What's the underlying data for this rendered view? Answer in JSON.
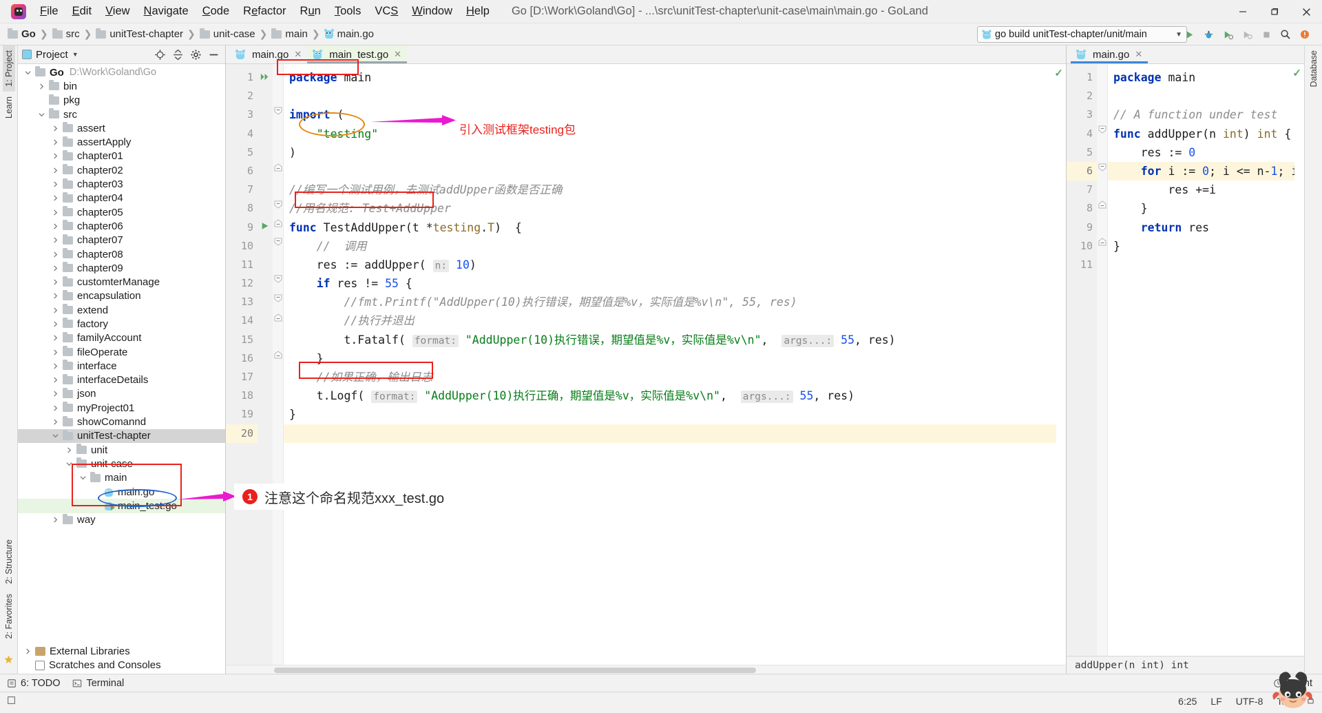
{
  "titlebar": {
    "menus": [
      "File",
      "Edit",
      "View",
      "Navigate",
      "Code",
      "Refactor",
      "Run",
      "Tools",
      "VCS",
      "Window",
      "Help"
    ],
    "window_title": "Go [D:\\Work\\Goland\\Go] - ...\\src\\unitTest-chapter\\unit-case\\main\\main.go - GoLand",
    "minimize": "—",
    "maximize": "❐",
    "close": "✕"
  },
  "navbar": {
    "breadcrumbs": [
      {
        "label": "Go",
        "icon": "folder-icon",
        "bold": true
      },
      {
        "label": "src",
        "icon": "folder-icon",
        "bold": false
      },
      {
        "label": "unitTest-chapter",
        "icon": "folder-icon",
        "bold": false
      },
      {
        "label": "unit-case",
        "icon": "folder-icon",
        "bold": false
      },
      {
        "label": "main",
        "icon": "folder-icon",
        "bold": false
      },
      {
        "label": "main.go",
        "icon": "go-file-icon",
        "bold": false
      }
    ],
    "run_config": "go build unitTest-chapter/unit/main",
    "icons": [
      "run-icon",
      "debug-icon",
      "run-with-coverage-icon",
      "profile-icon",
      "stop-icon",
      "search-icon",
      "updates-icon"
    ]
  },
  "left_strip": {
    "tabs": [
      {
        "label": "1: Project",
        "selected": true
      },
      {
        "label": "Learn",
        "selected": false
      }
    ],
    "bottom": [
      {
        "label": "2: Structure"
      },
      {
        "label": "2: Favorites"
      }
    ]
  },
  "project_panel": {
    "title": "Project",
    "actions": [
      "locate-icon",
      "collapse-all-icon",
      "settings-icon",
      "hide-icon"
    ],
    "tree": [
      {
        "depth": 0,
        "arrow": "down",
        "icon": "folder-icon",
        "label": "Go",
        "bold": true,
        "path": "D:\\Work\\Goland\\Go"
      },
      {
        "depth": 1,
        "arrow": "right",
        "icon": "folder-icon",
        "label": "bin"
      },
      {
        "depth": 1,
        "arrow": "none",
        "icon": "folder-icon",
        "label": "pkg"
      },
      {
        "depth": 1,
        "arrow": "down",
        "icon": "folder-icon",
        "label": "src"
      },
      {
        "depth": 2,
        "arrow": "right",
        "icon": "folder-icon",
        "label": "assert"
      },
      {
        "depth": 2,
        "arrow": "right",
        "icon": "folder-icon",
        "label": "assertApply"
      },
      {
        "depth": 2,
        "arrow": "right",
        "icon": "folder-icon",
        "label": "chapter01"
      },
      {
        "depth": 2,
        "arrow": "right",
        "icon": "folder-icon",
        "label": "chapter02"
      },
      {
        "depth": 2,
        "arrow": "right",
        "icon": "folder-icon",
        "label": "chapter03"
      },
      {
        "depth": 2,
        "arrow": "right",
        "icon": "folder-icon",
        "label": "chapter04"
      },
      {
        "depth": 2,
        "arrow": "right",
        "icon": "folder-icon",
        "label": "chapter05"
      },
      {
        "depth": 2,
        "arrow": "right",
        "icon": "folder-icon",
        "label": "chapter06"
      },
      {
        "depth": 2,
        "arrow": "right",
        "icon": "folder-icon",
        "label": "chapter07"
      },
      {
        "depth": 2,
        "arrow": "right",
        "icon": "folder-icon",
        "label": "chapter08"
      },
      {
        "depth": 2,
        "arrow": "right",
        "icon": "folder-icon",
        "label": "chapter09"
      },
      {
        "depth": 2,
        "arrow": "right",
        "icon": "folder-icon",
        "label": "customterManage"
      },
      {
        "depth": 2,
        "arrow": "right",
        "icon": "folder-icon",
        "label": "encapsulation"
      },
      {
        "depth": 2,
        "arrow": "right",
        "icon": "folder-icon",
        "label": "extend"
      },
      {
        "depth": 2,
        "arrow": "right",
        "icon": "folder-icon",
        "label": "factory"
      },
      {
        "depth": 2,
        "arrow": "right",
        "icon": "folder-icon",
        "label": "familyAccount"
      },
      {
        "depth": 2,
        "arrow": "right",
        "icon": "folder-icon",
        "label": "fileOperate"
      },
      {
        "depth": 2,
        "arrow": "right",
        "icon": "folder-icon",
        "label": "interface"
      },
      {
        "depth": 2,
        "arrow": "right",
        "icon": "folder-icon",
        "label": "interfaceDetails"
      },
      {
        "depth": 2,
        "arrow": "right",
        "icon": "folder-icon",
        "label": "json"
      },
      {
        "depth": 2,
        "arrow": "right",
        "icon": "folder-icon",
        "label": "myProject01"
      },
      {
        "depth": 2,
        "arrow": "right",
        "icon": "folder-icon",
        "label": "showComannd"
      },
      {
        "depth": 2,
        "arrow": "down",
        "icon": "folder-icon",
        "label": "unitTest-chapter",
        "selected": true
      },
      {
        "depth": 3,
        "arrow": "right",
        "icon": "folder-icon",
        "label": "unit"
      },
      {
        "depth": 3,
        "arrow": "down",
        "icon": "folder-icon",
        "label": "unit-case"
      },
      {
        "depth": 4,
        "arrow": "down",
        "icon": "folder-icon",
        "label": "main"
      },
      {
        "depth": 5,
        "arrow": "none",
        "icon": "go-file-icon",
        "label": "main.go"
      },
      {
        "depth": 5,
        "arrow": "none",
        "icon": "go-test-file-icon",
        "label": "main_test.go",
        "green": true
      },
      {
        "depth": 2,
        "arrow": "right",
        "icon": "folder-icon",
        "label": "way"
      }
    ],
    "footer": [
      {
        "arrow": "right",
        "icon": "library-icon",
        "label": "External Libraries"
      },
      {
        "arrow": "none",
        "icon": "scratch-icon",
        "label": "Scratches and Consoles"
      }
    ]
  },
  "editor_left": {
    "tabs": [
      {
        "label": "main.go",
        "icon": "go-file-icon",
        "active": false
      },
      {
        "label": "main_test.go",
        "icon": "go-test-file-icon",
        "active": true
      }
    ],
    "line_numbers": [
      "1",
      "2",
      "3",
      "4",
      "5",
      "6",
      "7",
      "8",
      "9",
      "10",
      "11",
      "12",
      "13",
      "14",
      "15",
      "16",
      "17",
      "18",
      "19",
      "20"
    ],
    "lines": [
      "package main",
      "",
      "import (",
      "    \"testing\"",
      ")",
      "",
      "//编写一个测试用例，去测试addUpper函数是否正确",
      "//用名规范: Test+AddUpper",
      "func TestAddUpper(t *testing.T)  {",
      "    //  调用",
      "    res := addUpper( n: 10)",
      "    if res != 55 {",
      "        //fmt.Printf(\"AddUpper(10)执行错误，期望值是%v，实际值是%v\\n\", 55, res)",
      "        //执行并退出",
      "        t.Fatalf( format: \"AddUpper(10)执行错误，期望值是%v，实际值是%v\\n\",  args...: 55, res)",
      "    }",
      "    //如果正确，输出日志",
      "    t.Logf( format: \"AddUpper(10)执行正确，期望值是%v，实际值是%v\\n\",  args...: 55, res)",
      "}",
      ""
    ],
    "highlighted_line": 20
  },
  "editor_right": {
    "tabs": [
      {
        "label": "main.go",
        "icon": "go-file-icon",
        "active": true
      }
    ],
    "line_numbers": [
      "1",
      "2",
      "3",
      "4",
      "5",
      "6",
      "7",
      "8",
      "9",
      "10",
      "11"
    ],
    "lines": [
      "package main",
      "",
      "// A function under test",
      "func addUpper(n int) int {",
      "    res := 0",
      "    for i := 0; i <= n-1; i++ {",
      "        res +=i",
      "    }",
      "    return res",
      "}",
      ""
    ],
    "highlighted_line": 6,
    "status": "addUpper(n int) int"
  },
  "annotations": {
    "testing_note": "引入测试框架testing包",
    "filename_note": "注意这个命名规范xxx_test.go",
    "filename_badge": "1"
  },
  "bottom_toolbar": {
    "items": [
      {
        "label": "6: TODO",
        "icon": "todo-icon"
      },
      {
        "label": "Terminal",
        "icon": "terminal-icon"
      }
    ],
    "right": [
      {
        "label": "Event",
        "icon": "event-icon"
      }
    ]
  },
  "statusbar": {
    "caret": "6:25",
    "line_separator": "LF",
    "encoding": "UTF-8",
    "indent": "Tab",
    "lock_icon": "lock-icon"
  },
  "right_strip": {
    "tabs": [
      {
        "label": "Database"
      }
    ]
  },
  "colors": {
    "accent_red": "#e8211c",
    "accent_magenta": "#e91ad0",
    "accent_orange": "#e8860a",
    "keyword_blue": "#0033b3",
    "string_green": "#067d17",
    "number_blue": "#1750eb",
    "comment_gray": "#8c8c8c",
    "type_gold": "#8a6b27",
    "highlight_yellow": "#fdf6dd",
    "selection_gray": "#d4d4d4",
    "tab_green": "#edf5e4"
  }
}
